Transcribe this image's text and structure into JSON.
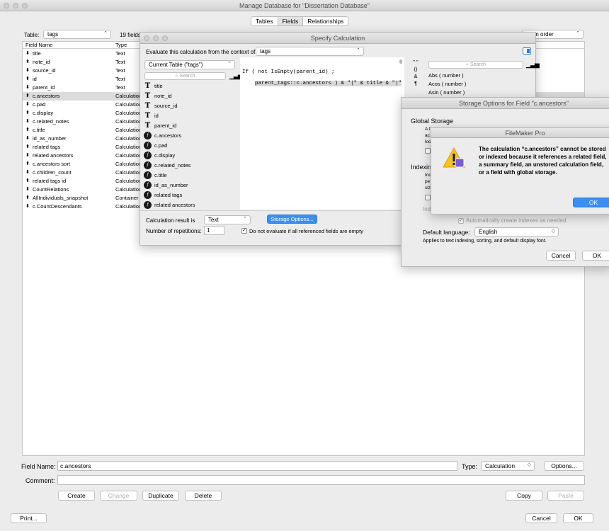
{
  "main_window": {
    "title": "Manage Database for \"Dissertation Database\"",
    "tabs": [
      "Tables",
      "Fields",
      "Relationships"
    ],
    "table_label": "Table:",
    "table_value": "tags",
    "field_count": "19 fields",
    "view_by_value": "...om order",
    "col_name": "Field Name",
    "col_type": "Type",
    "fields": [
      {
        "name": "title",
        "type": "Text"
      },
      {
        "name": "note_id",
        "type": "Text"
      },
      {
        "name": "source_id",
        "type": "Text"
      },
      {
        "name": "id",
        "type": "Text"
      },
      {
        "name": "parent_id",
        "type": "Text"
      },
      {
        "name": "c.ancestors",
        "type": "Calculation"
      },
      {
        "name": "c.pad",
        "type": "Calculation"
      },
      {
        "name": "c.display",
        "type": "Calculation"
      },
      {
        "name": "c.related_notes",
        "type": "Calculation"
      },
      {
        "name": "c.title",
        "type": "Calculation"
      },
      {
        "name": "id_as_number",
        "type": "Calculation"
      },
      {
        "name": "related tags",
        "type": "Calculation"
      },
      {
        "name": "related ancestors",
        "type": "Calculation"
      },
      {
        "name": "c.ancestors sort",
        "type": "Calculation"
      },
      {
        "name": "c.children_count",
        "type": "Calculation"
      },
      {
        "name": "related tags id",
        "type": "Calculation"
      },
      {
        "name": "CountRelations",
        "type": "Calculation"
      },
      {
        "name": "AllIndividuals_snapshot",
        "type": "Container"
      },
      {
        "name": "c.CountDescendants",
        "type": "Calculation"
      }
    ],
    "field_name_label": "Field Name:",
    "field_name_value": "c.ancestors",
    "type_label": "Type:",
    "type_value": "Calculation",
    "options_btn": "Options...",
    "comment_label": "Comment:",
    "create_btn": "Create",
    "change_btn": "Change",
    "duplicate_btn": "Duplicate",
    "delete_btn": "Delete",
    "copy_btn": "Copy",
    "paste_btn": "Paste",
    "print_btn": "Print...",
    "cancel_btn": "Cancel",
    "ok_btn": "OK"
  },
  "calc_window": {
    "title": "Specify Calculation",
    "context_label": "Evaluate this calculation from the context of:",
    "context_value": "tags",
    "table_sel": "Current Table (\"tags\")",
    "search_placeholder": "Search",
    "fields": [
      {
        "name": "title",
        "kind": "T"
      },
      {
        "name": "note_id",
        "kind": "T"
      },
      {
        "name": "source_id",
        "kind": "T"
      },
      {
        "name": "id",
        "kind": "T"
      },
      {
        "name": "parent_id",
        "kind": "T"
      },
      {
        "name": "c.ancestors",
        "kind": "c"
      },
      {
        "name": "c.pad",
        "kind": "c"
      },
      {
        "name": "c.display",
        "kind": "c"
      },
      {
        "name": "c.related_notes",
        "kind": "c"
      },
      {
        "name": "c.title",
        "kind": "c"
      },
      {
        "name": "id_as_number",
        "kind": "c"
      },
      {
        "name": "related tags",
        "kind": "c"
      },
      {
        "name": "related ancestors",
        "kind": "c"
      }
    ],
    "formula_line1": "If ( not IsEmpty(parent_id) ;",
    "formula_line2": "parent_tags::c.ancestors ) & \"|\" & title & \"|\"",
    "operators": [
      "\" \"",
      "()",
      "&",
      "¶"
    ],
    "functions": [
      "Abs ( number )",
      "Acos ( number )",
      "Asin ( number )"
    ],
    "result_label": "Calculation result is",
    "result_value": "Text",
    "storage_btn": "Storage Options...",
    "repetitions_label": "Number of repetitions:",
    "repetitions_value": "1",
    "no_eval_label": "Do not evaluate if all referenced fields are empty"
  },
  "storage_window": {
    "title": "Storage Options for Field \"c.ancestors\"",
    "global_heading": "Global Storage",
    "global_desc_fragments": [
      "A f",
      "ac",
      "loc"
    ],
    "indexing_heading": "Indexin",
    "indexing_desc_fragments": [
      "Ind",
      "pe",
      "siz"
    ],
    "index_label_fragment": "Ind",
    "auto_index_label": "Automatically create indexes as needed",
    "lang_label": "Default language:",
    "lang_value": "English",
    "applies_text": "Applies to text indexing, sorting, and default display font.",
    "cancel_btn": "Cancel",
    "ok_btn": "OK"
  },
  "alert": {
    "title": "FileMaker Pro",
    "message": "The calculation “c.ancestors” cannot be stored or indexed because it references a related field, a summary field, an unstored calculation field, or a field with global storage.",
    "ok_btn": "OK"
  }
}
